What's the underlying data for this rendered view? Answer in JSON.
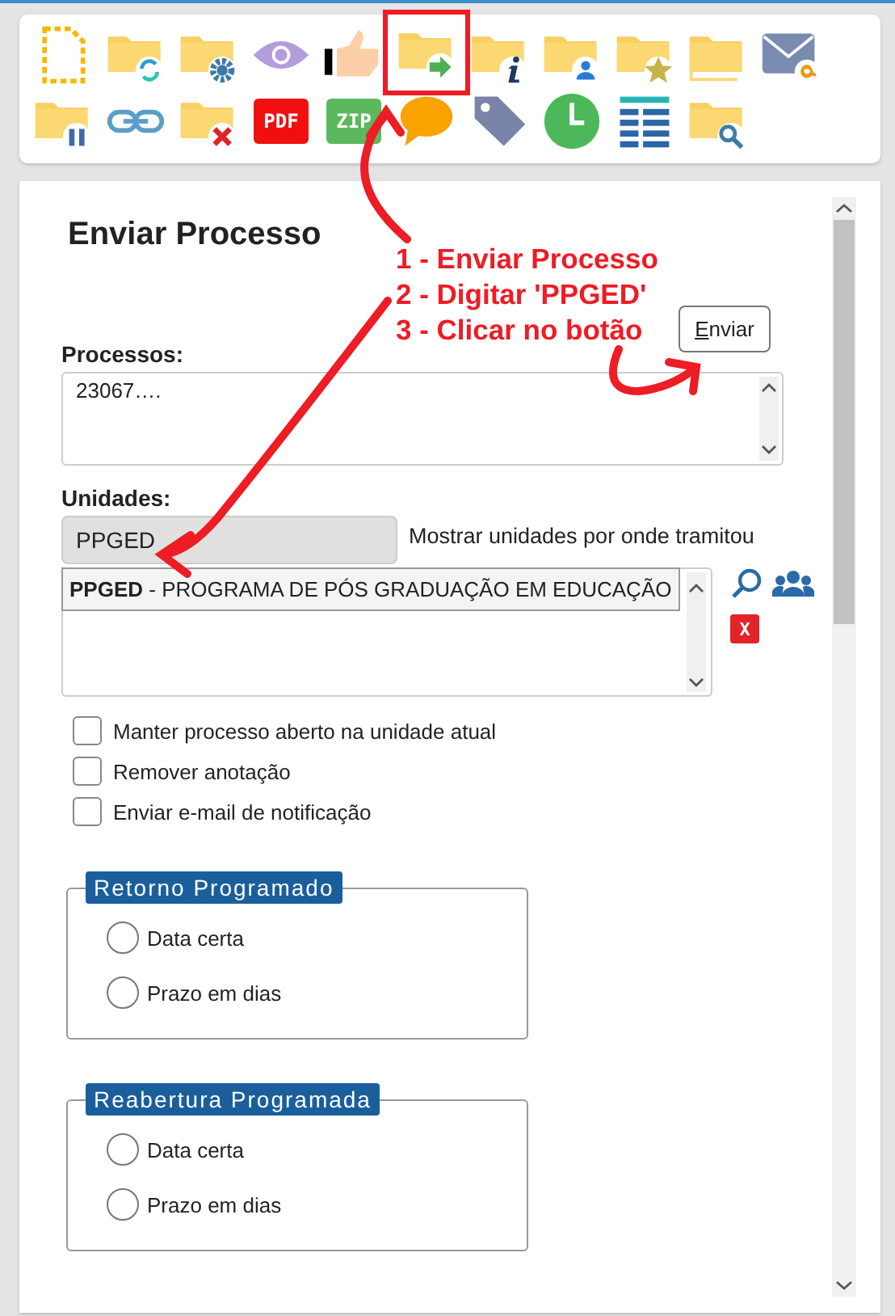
{
  "toolbar": {
    "rows": [
      [
        {
          "kind": "document",
          "highlighted": false
        },
        {
          "kind": "refresh",
          "highlighted": false
        },
        {
          "kind": "settings",
          "highlighted": false
        },
        {
          "kind": "eye",
          "highlighted": false
        },
        {
          "kind": "thumb",
          "highlighted": false
        },
        {
          "kind": "send",
          "highlighted": true
        },
        {
          "kind": "info",
          "highlighted": false
        },
        {
          "kind": "person",
          "highlighted": false
        },
        {
          "kind": "star",
          "highlighted": false
        },
        {
          "kind": "folders",
          "highlighted": false
        },
        {
          "kind": "email",
          "highlighted": false
        }
      ],
      [
        {
          "kind": "pause",
          "highlighted": false
        },
        {
          "kind": "link",
          "highlighted": false
        },
        {
          "kind": "delete",
          "highlighted": false
        },
        {
          "kind": "pdf",
          "text": "PDF",
          "highlighted": false
        },
        {
          "kind": "zip",
          "text": "ZIP",
          "highlighted": false
        },
        {
          "kind": "comment",
          "highlighted": false
        },
        {
          "kind": "tag",
          "highlighted": false
        },
        {
          "kind": "clock",
          "highlighted": false
        },
        {
          "kind": "list",
          "highlighted": false
        },
        {
          "kind": "search",
          "highlighted": false
        }
      ]
    ]
  },
  "form": {
    "title": "Enviar Processo",
    "submit_button": "Enviar",
    "processos": {
      "label": "Processos:",
      "value": "23067…."
    },
    "unidades": {
      "label": "Unidades:",
      "value": "PPGED",
      "link": "Mostrar unidades por onde tramitou",
      "suggestion": "**PPGED** - PROGRAMA DE PÓS GRADUAÇÃO EM EDUCAÇÃO",
      "remove_button": "X"
    },
    "options": [
      {
        "label": "Manter processo aberto na unidade atual",
        "checked": false
      },
      {
        "label": "Remover anotação",
        "checked": false
      },
      {
        "label": "Enviar e-mail de notificação",
        "checked": false
      }
    ],
    "groups": [
      {
        "legend": "Retorno Programado",
        "choices": [
          {
            "label": "Data certa",
            "selected": false
          },
          {
            "label": "Prazo em dias",
            "selected": false
          }
        ]
      },
      {
        "legend": "Reabertura Programada",
        "choices": [
          {
            "label": "Data certa",
            "selected": false
          },
          {
            "label": "Prazo em dias",
            "selected": false
          }
        ]
      }
    ]
  },
  "annotations": {
    "steps": [
      "1 - Enviar Processo",
      "2 - Digitar 'PPGED'",
      "3 - Clicar no botão"
    ]
  }
}
